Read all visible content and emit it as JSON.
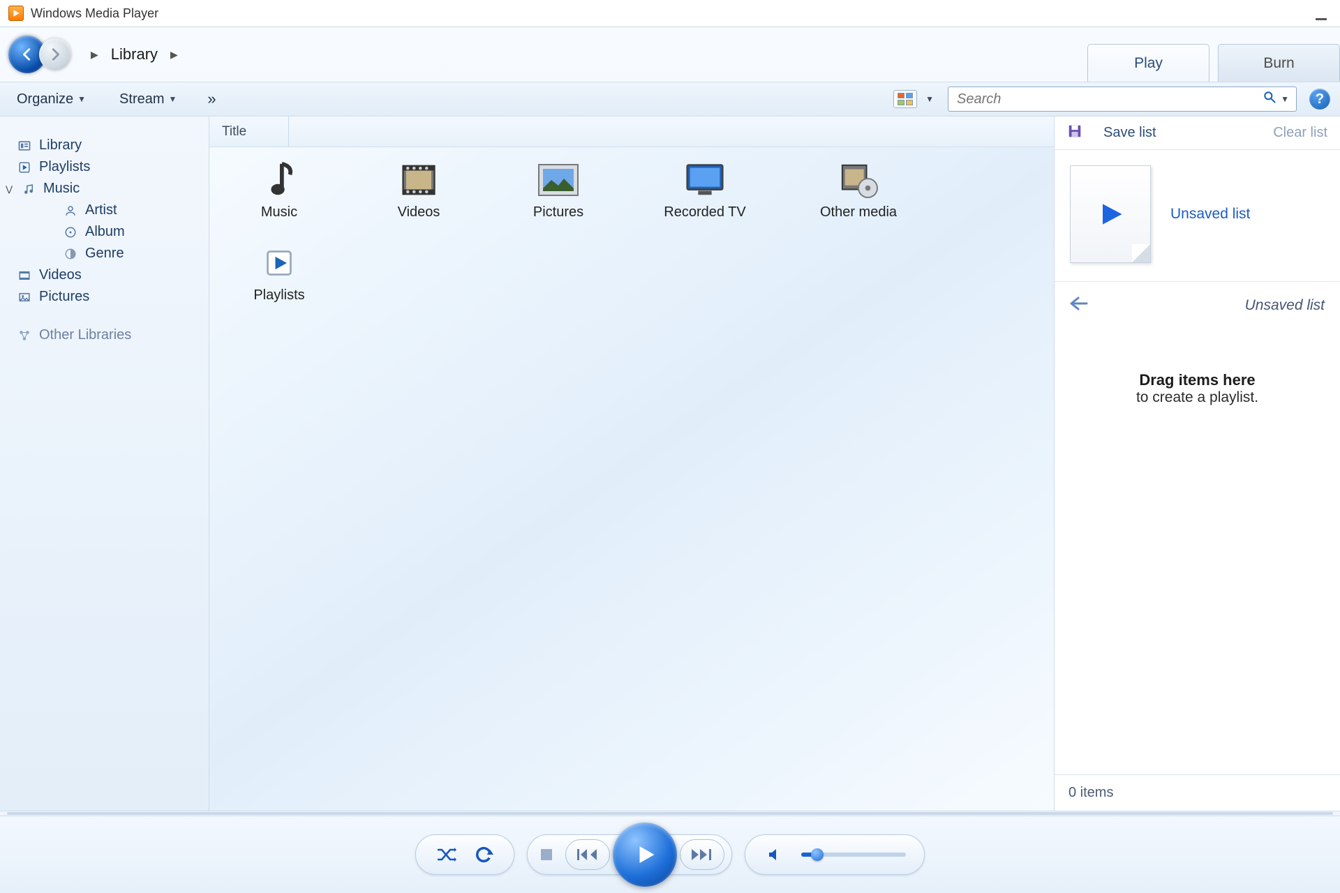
{
  "titlebar": {
    "title": "Windows Media Player"
  },
  "breadcrumb": {
    "root": "Library"
  },
  "tabs": {
    "play": "Play",
    "burn": "Burn"
  },
  "toolbar": {
    "organize": "Organize",
    "stream": "Stream",
    "overflow": "»"
  },
  "search": {
    "placeholder": "Search"
  },
  "sidebar": {
    "library": "Library",
    "playlists": "Playlists",
    "music": "Music",
    "artist": "Artist",
    "album": "Album",
    "genre": "Genre",
    "videos": "Videos",
    "pictures": "Pictures",
    "other_libraries": "Other Libraries"
  },
  "content": {
    "col_title": "Title",
    "items": {
      "music": "Music",
      "videos": "Videos",
      "pictures": "Pictures",
      "recorded_tv": "Recorded TV",
      "other_media": "Other media",
      "playlists": "Playlists"
    }
  },
  "rightpane": {
    "save_list": "Save list",
    "clear_list": "Clear list",
    "unsaved_title": "Unsaved list",
    "unsaved_sub": "Unsaved list",
    "drag_line1": "Drag items here",
    "drag_line2": "to create a playlist.",
    "item_count": "0 items"
  }
}
